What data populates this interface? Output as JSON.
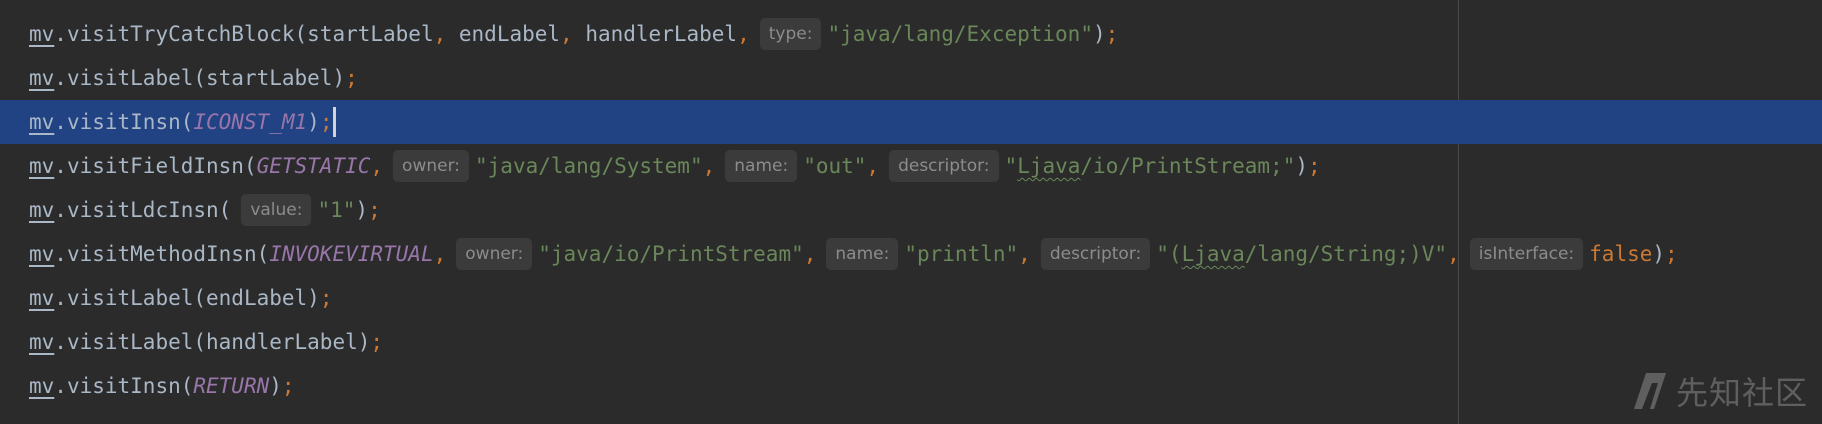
{
  "editor": {
    "lines": [
      {
        "id": "l1",
        "segments": [
          {
            "t": "mv",
            "c": "mv"
          },
          {
            "t": ".visitTryCatchBlock(startLabel",
            "c": "plain"
          },
          {
            "t": ",",
            "c": "punct"
          },
          {
            "t": " endLabel",
            "c": "plain"
          },
          {
            "t": ",",
            "c": "punct"
          },
          {
            "t": " handlerLabel",
            "c": "plain"
          },
          {
            "t": ",",
            "c": "punct"
          },
          {
            "hint": "type:"
          },
          {
            "t": "\"java/lang/Exception\"",
            "c": "str"
          },
          {
            "t": ")",
            "c": "plain"
          },
          {
            "t": ";",
            "c": "punct"
          }
        ]
      },
      {
        "id": "l2",
        "segments": [
          {
            "t": "mv",
            "c": "mv"
          },
          {
            "t": ".visitLabel(startLabel)",
            "c": "plain"
          },
          {
            "t": ";",
            "c": "punct"
          }
        ]
      },
      {
        "id": "l3",
        "current": true,
        "segments": [
          {
            "t": "mv",
            "c": "mv"
          },
          {
            "t": ".visitInsn(",
            "c": "plain"
          },
          {
            "t": "ICONST_M1",
            "c": "const"
          },
          {
            "t": ")",
            "c": "plain"
          },
          {
            "t": ";",
            "c": "punct"
          },
          {
            "caret": true
          }
        ]
      },
      {
        "id": "l4",
        "segments": [
          {
            "t": "mv",
            "c": "mv"
          },
          {
            "t": ".visitFieldInsn(",
            "c": "plain"
          },
          {
            "t": "GETSTATIC",
            "c": "const"
          },
          {
            "t": ",",
            "c": "punct"
          },
          {
            "hint": "owner:"
          },
          {
            "t": "\"java/lang/System\"",
            "c": "str"
          },
          {
            "t": ",",
            "c": "punct"
          },
          {
            "hint": "name:"
          },
          {
            "t": "\"out\"",
            "c": "str"
          },
          {
            "t": ",",
            "c": "punct"
          },
          {
            "hint": "descriptor:"
          },
          {
            "t": "\"",
            "c": "str"
          },
          {
            "t": "Ljava",
            "c": "str squiggle"
          },
          {
            "t": "/io/PrintStream;\"",
            "c": "str"
          },
          {
            "t": ")",
            "c": "plain"
          },
          {
            "t": ";",
            "c": "punct"
          }
        ]
      },
      {
        "id": "l5",
        "segments": [
          {
            "t": "mv",
            "c": "mv"
          },
          {
            "t": ".visitLdcInsn(",
            "c": "plain"
          },
          {
            "hint": "value:"
          },
          {
            "t": "\"1\"",
            "c": "str"
          },
          {
            "t": ")",
            "c": "plain"
          },
          {
            "t": ";",
            "c": "punct"
          }
        ]
      },
      {
        "id": "l6",
        "segments": [
          {
            "t": "mv",
            "c": "mv"
          },
          {
            "t": ".visitMethodInsn(",
            "c": "plain"
          },
          {
            "t": "INVOKEVIRTUAL",
            "c": "const"
          },
          {
            "t": ",",
            "c": "punct"
          },
          {
            "hint": "owner:"
          },
          {
            "t": "\"java/io/PrintStream\"",
            "c": "str"
          },
          {
            "t": ",",
            "c": "punct"
          },
          {
            "hint": "name:"
          },
          {
            "t": "\"println\"",
            "c": "str"
          },
          {
            "t": ",",
            "c": "punct"
          },
          {
            "hint": "descriptor:"
          },
          {
            "t": "\"(",
            "c": "str"
          },
          {
            "t": "Ljava",
            "c": "str squiggle"
          },
          {
            "t": "/lang/String;)V\"",
            "c": "str"
          },
          {
            "t": ",",
            "c": "punct"
          },
          {
            "hint": "isInterface:"
          },
          {
            "t": "false",
            "c": "kw"
          },
          {
            "t": ")",
            "c": "plain"
          },
          {
            "t": ";",
            "c": "punct"
          }
        ]
      },
      {
        "id": "l7",
        "segments": [
          {
            "t": "mv",
            "c": "mv"
          },
          {
            "t": ".visitLabel(endLabel)",
            "c": "plain"
          },
          {
            "t": ";",
            "c": "punct"
          }
        ]
      },
      {
        "id": "l8",
        "segments": [
          {
            "t": "mv",
            "c": "mv"
          },
          {
            "t": ".visitLabel(handlerLabel)",
            "c": "plain"
          },
          {
            "t": ";",
            "c": "punct"
          }
        ]
      },
      {
        "id": "l9",
        "segments": [
          {
            "t": "mv",
            "c": "mv"
          },
          {
            "t": ".visitInsn(",
            "c": "plain"
          },
          {
            "t": "RETURN",
            "c": "const"
          },
          {
            "t": ")",
            "c": "plain"
          },
          {
            "t": ";",
            "c": "punct"
          }
        ]
      }
    ]
  },
  "colors": {
    "background": "#2b2b2b",
    "current_line": "#214283",
    "default_text": "#a9b7c6",
    "keyword_orange": "#cc7832",
    "constant_purple": "#9876aa",
    "string_green": "#6a8759",
    "hint_background": "#3b3b3b",
    "hint_text": "#8c8c8c"
  },
  "watermark": {
    "text": "先知社区",
    "icon": "xianzhi-logo-icon"
  }
}
